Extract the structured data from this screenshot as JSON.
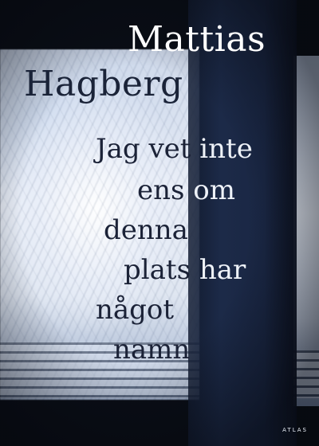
{
  "author": {
    "first": "Mattias",
    "last": "Hagberg"
  },
  "title_lines": [
    {
      "dark": "Jag vet",
      "light": "inte"
    },
    {
      "dark": "ens",
      "light": "om"
    },
    {
      "dark": "denna",
      "light": ""
    },
    {
      "dark": "plats",
      "light": "har"
    },
    {
      "dark": "något",
      "light": ""
    },
    {
      "dark": "namn",
      "light": ""
    }
  ],
  "publisher": "ATLAS",
  "colors": {
    "frame": "#0a0e16",
    "shadow": "#1c2a48",
    "frost": "#e9eef7",
    "dark_text": "#1b2237",
    "light_text": "#eef2f8"
  }
}
